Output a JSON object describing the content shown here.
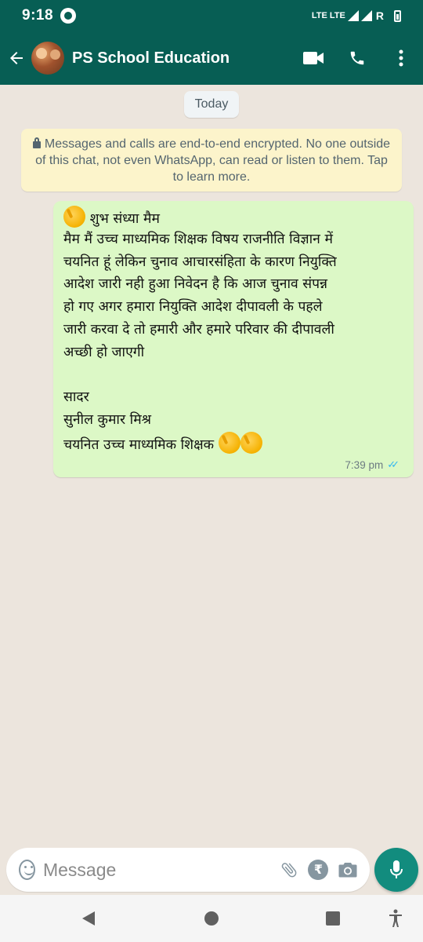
{
  "status_bar": {
    "time": "9:18",
    "network": "LTE LTE",
    "roaming": "R"
  },
  "app_bar": {
    "back_icon": "arrow-left-icon",
    "contact_name": "PS School Education",
    "video_icon": "video-call-icon",
    "call_icon": "phone-icon",
    "more_icon": "more-vertical-icon"
  },
  "chat": {
    "date_chip": "Today",
    "encryption_notice": "Messages and calls are end-to-end encrypted. No one outside of this chat, not even WhatsApp, can read or listen to them. Tap to learn more.",
    "message": {
      "lines": [
        "शुभ संध्या मैम",
        "मैम मैं  उच्च माध्यमिक शिक्षक विषय राजनीति विज्ञान में",
        "चयनित हूं लेकिन चुनाव आचारसंहिता के कारण नियुक्ति",
        "आदेश जारी नही हुआ निवेदन है कि आज चुनाव संपन्न",
        "हो गए अगर हमारा नियुक्ति आदेश दीपावली के पहले",
        "जारी करवा दे  तो हमारी और हमारे परिवार की दीपावली",
        "अच्छी हो जाएगी",
        "",
        "सादर",
        "सुनील कुमार मिश्र",
        "चयनित उच्च माध्यमिक शिक्षक"
      ],
      "emoji": "clapping-hands",
      "time": "7:39 pm",
      "ticks": "✓✓",
      "tick_color": "#34B7F1",
      "bubble_color": "#DCF8C6"
    }
  },
  "composer": {
    "placeholder": "Message",
    "emoji_icon": "emoji-icon",
    "attach_icon": "paperclip-icon",
    "payment_icon": "rupee-icon",
    "payment_symbol": "₹",
    "camera_icon": "camera-icon",
    "mic_icon": "microphone-icon"
  },
  "colors": {
    "header": "#075E54",
    "accent": "#128C7E",
    "chat_bg": "#ECE5DD",
    "notice_bg": "#FCF4CB"
  }
}
